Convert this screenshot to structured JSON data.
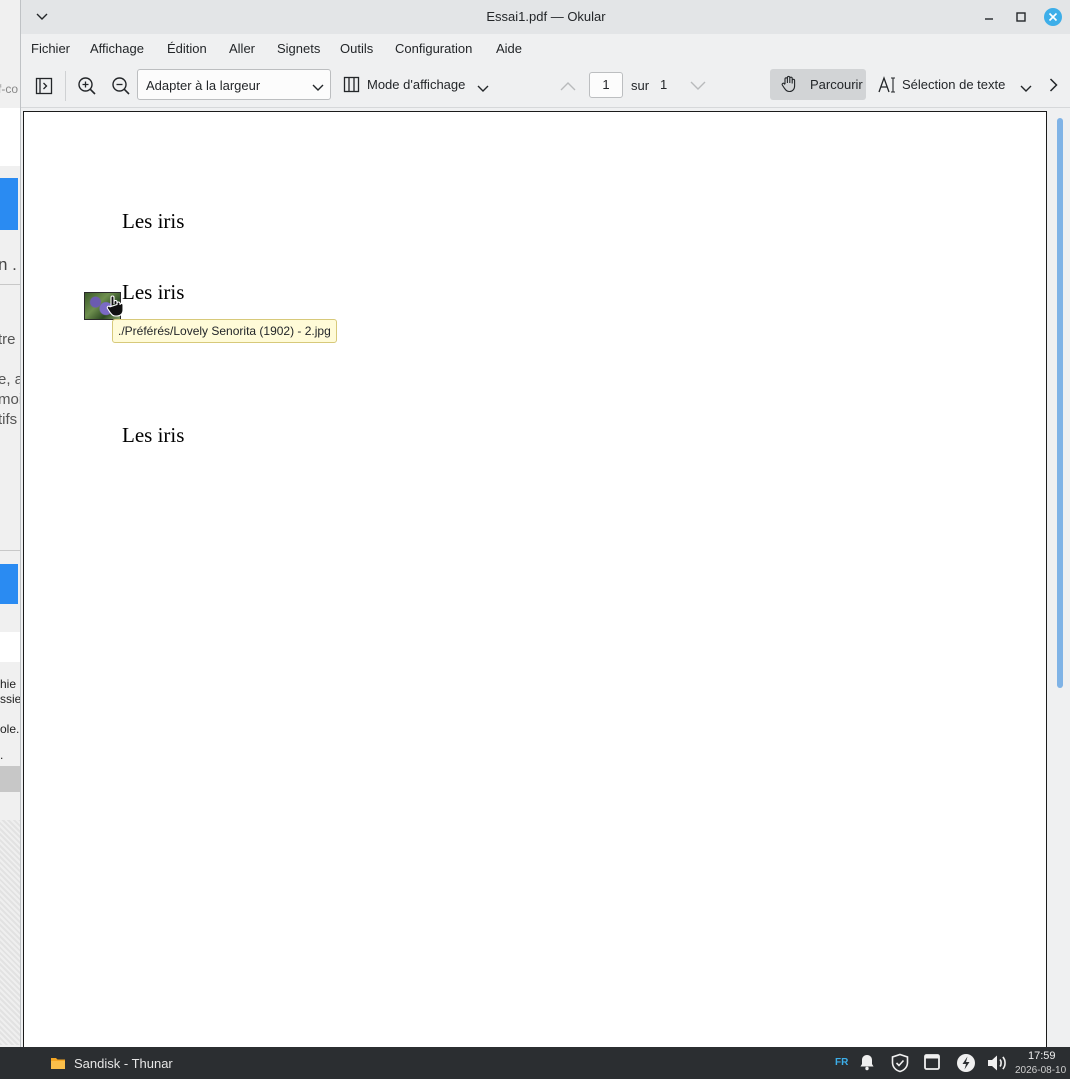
{
  "window": {
    "title": "Essai1.pdf — Okular"
  },
  "menu": {
    "items": [
      "Fichier",
      "Affichage",
      "Édition",
      "Aller",
      "Signets",
      "Outils",
      "Configuration",
      "Aide"
    ]
  },
  "toolbar": {
    "zoom_value": "Adapter à la largeur",
    "view_mode_label": "Mode d'affichage",
    "page_current": "1",
    "of_label": "sur",
    "page_total": "1",
    "browse_label": "Parcourir",
    "text_select_label": "Sélection de texte"
  },
  "document": {
    "lines": [
      "Les iris",
      "Les iris",
      "Les iris"
    ],
    "tooltip": "./Préférés/Lovely Senorita (1902) - 2.jpg"
  },
  "background_window": {
    "fragments": [
      "f-co",
      "n .",
      "tre",
      "e, a",
      "moi",
      "tifs",
      "hie",
      "ssie",
      "ole.",
      "."
    ]
  },
  "taskbar": {
    "task_label": "Sandisk - Thunar",
    "keyboard_layout": "FR",
    "clock_time": "17:59",
    "clock_date": "2026-08-10"
  },
  "colors": {
    "accent": "#3daee9",
    "close_button": "#3daee9",
    "taskbar": "#2b2e31",
    "tooltip_bg": "#fffbd8"
  }
}
